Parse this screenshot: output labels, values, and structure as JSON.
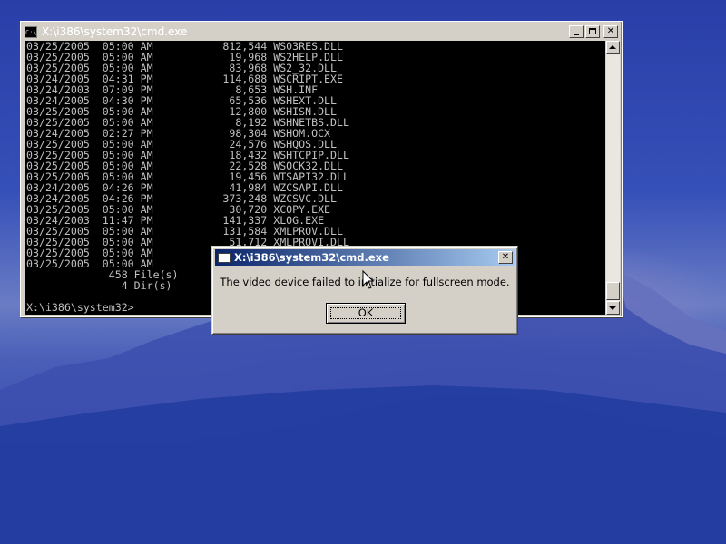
{
  "desktop": {
    "wallpaper": "mountain-lake"
  },
  "cmd_window": {
    "icon": "cmd-prompt-icon",
    "title": "X:\\i386\\system32\\cmd.exe",
    "buttons": {
      "minimize_icon": "minimize-icon",
      "maximize_icon": "maximize-icon",
      "close_glyph": "✕"
    },
    "console_lines": [
      "03/25/2005  05:00 AM           812,544 WS03RES.DLL",
      "03/25/2005  05:00 AM            19,968 WS2HELP.DLL",
      "03/25/2005  05:00 AM            83,968 WS2_32.DLL",
      "03/24/2005  04:31 PM           114,688 WSCRIPT.EXE",
      "03/24/2003  07:09 PM             8,653 WSH.INF",
      "03/24/2005  04:30 PM            65,536 WSHEXT.DLL",
      "03/25/2005  05:00 AM            12,800 WSHISN.DLL",
      "03/25/2005  05:00 AM             8,192 WSHNETBS.DLL",
      "03/24/2005  02:27 PM            98,304 WSHOM.OCX",
      "03/25/2005  05:00 AM            24,576 WSHQOS.DLL",
      "03/25/2005  05:00 AM            18,432 WSHTCPIP.DLL",
      "03/25/2005  05:00 AM            22,528 WSOCK32.DLL",
      "03/25/2005  05:00 AM            19,456 WTSAPI32.DLL",
      "03/24/2005  04:26 PM            41,984 WZCSAPI.DLL",
      "03/24/2005  04:26 PM           373,248 WZCSVC.DLL",
      "03/25/2005  05:00 AM            30,720 XCOPY.EXE",
      "03/24/2003  11:47 PM           141,337 XLOG.EXE",
      "03/25/2005  05:00 AM           131,584 XMLPROV.DLL",
      "03/25/2005  05:00 AM            51,712 XMLPROVI.DLL",
      "03/25/2005  05:00 AM",
      "03/25/2005  05:00 AM",
      "             458 File(s)",
      "               4 Dir(s)",
      "",
      "X:\\i386\\system32>"
    ],
    "scrollbar": {
      "up_icon": "scroll-up-arrow-icon",
      "down_icon": "scroll-down-arrow-icon"
    }
  },
  "dialog": {
    "icon": "window-icon",
    "title": "X:\\i386\\system32\\cmd.exe",
    "close_glyph": "✕",
    "message": "The video device failed to initialize for fullscreen mode.",
    "ok_label": "OK"
  },
  "cursor": {
    "icon": "mouse-pointer-icon"
  }
}
